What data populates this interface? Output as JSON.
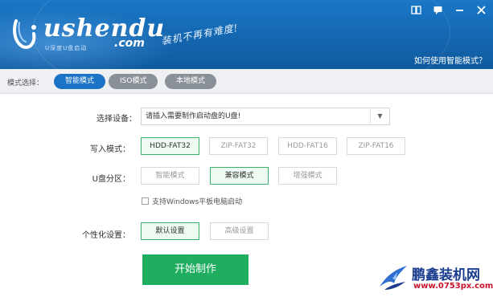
{
  "header": {
    "logo_word": "ushendu",
    "logo_com": ".com",
    "logo_sub": "U深度U盘启动",
    "slogan": "装机不再有难度!",
    "help_link": "如何使用智能模式？",
    "controls": [
      "skin-icon",
      "message-icon",
      "minimize-icon",
      "close-icon"
    ]
  },
  "modebar": {
    "label": "模式选择：",
    "modes": [
      "智能模式",
      "ISO模式",
      "本地模式"
    ],
    "active": "智能模式"
  },
  "form": {
    "device_label": "选择设备：",
    "device_value": "请插入需要制作启动盘的U盘!",
    "write_label": "写入模式：",
    "write_options": [
      "HDD-FAT32",
      "ZIP-FAT32",
      "HDD-FAT16",
      "ZIP-FAT16"
    ],
    "write_selected": "HDD-FAT32",
    "partition_label": "U盘分区：",
    "partition_options": [
      "智能模式",
      "兼容模式",
      "增强模式"
    ],
    "partition_selected": "兼容模式",
    "checkbox_label": "支持Windows平板电脑启动",
    "checkbox_checked": false,
    "personal_label": "个性化设置：",
    "personal_options": [
      "默认设置",
      "高级设置"
    ],
    "personal_selected": "默认设置",
    "start_button": "开始制作"
  },
  "watermark": {
    "name": "鹏鑫装机网",
    "url": "www.0753px.com"
  },
  "colors": {
    "header_blue": "#1466b0",
    "active_pill": "#1b73c6",
    "selected_green": "#39b36a",
    "start_green": "#1fae5f"
  }
}
